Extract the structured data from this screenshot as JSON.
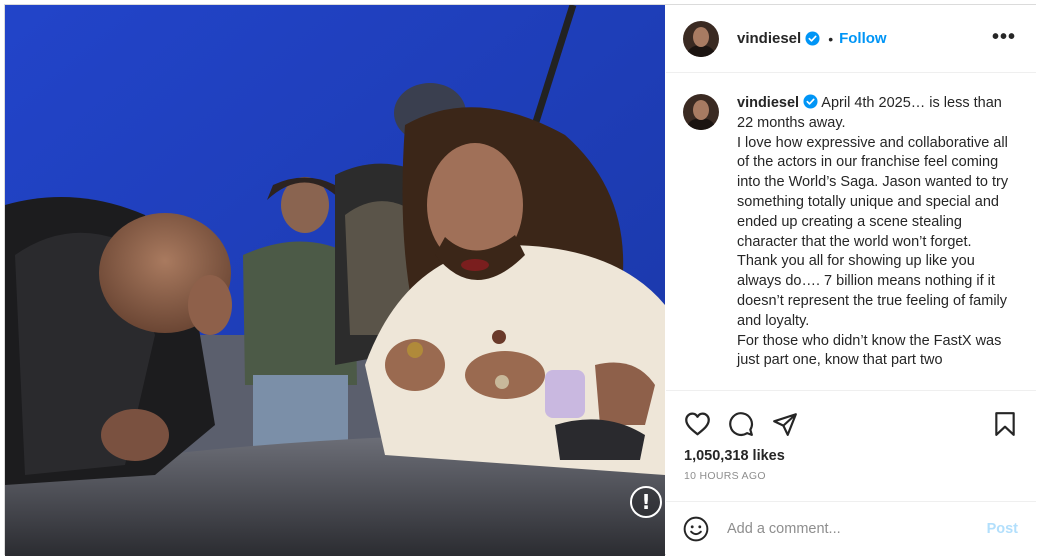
{
  "post": {
    "username": "vindiesel",
    "follow_label": "Follow",
    "separator": "•",
    "more_label": "•••",
    "alert_glyph": "!",
    "caption": {
      "username": "vindiesel",
      "lines": [
        "April 4th 2025… is less than 22 months away.",
        "I love how expressive and collaborative all of the actors in our franchise feel coming into the World’s Saga. Jason wanted to try something totally unique and special and ended up creating a scene stealing character that the world won’t forget. Thank you all for showing up like you always do…. 7 billion means nothing if it doesn’t represent the true feeling of family and loyalty.",
        "For those who didn’t know the FastX was just part one, know that part two"
      ]
    },
    "likes": "1,050,318 likes",
    "time_ago": "10 HOURS AGO",
    "comment_placeholder": "Add a comment...",
    "post_label": "Post"
  },
  "icons": {
    "verified": "verified-badge-icon",
    "like": "heart-icon",
    "comment": "comment-bubble-icon",
    "share": "paper-plane-icon",
    "save": "bookmark-icon",
    "emoji": "smiley-icon",
    "alert": "exclamation-circle-icon"
  },
  "colors": {
    "link_blue": "#0095f6",
    "post_disabled": "#b2dffc",
    "verified_blue": "#0095f6",
    "muted_gray": "#8e8e8e",
    "backdrop_blue": "#1f3fbf"
  }
}
